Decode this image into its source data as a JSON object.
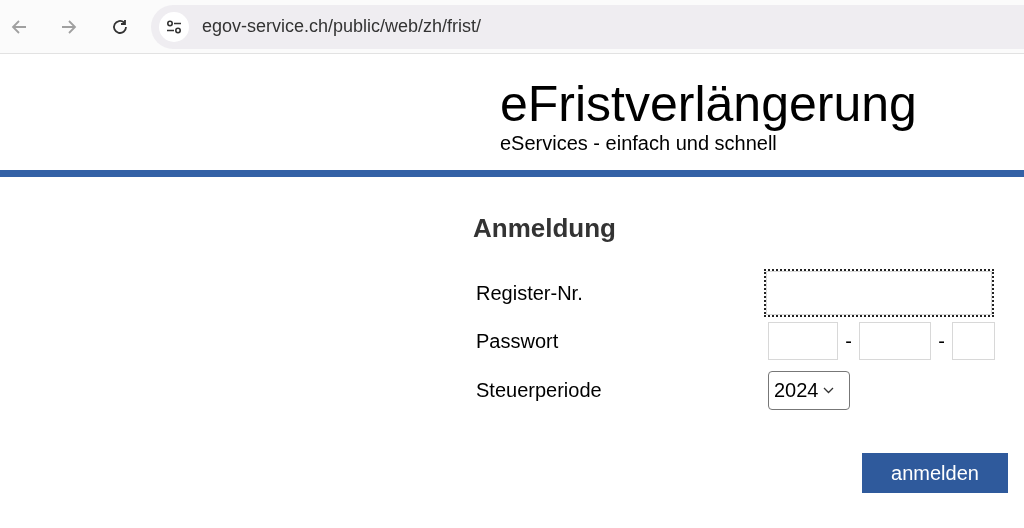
{
  "browser": {
    "url": "egov-service.ch/public/web/zh/frist/"
  },
  "header": {
    "title": "eFristverlängerung",
    "subtitle": "eServices - einfach und schnell"
  },
  "form": {
    "heading": "Anmeldung",
    "register": {
      "label": "Register-Nr.",
      "focused": true
    },
    "password": {
      "label": "Passwort",
      "separators": [
        "-",
        "-"
      ]
    },
    "period": {
      "label": "Steuerperiode",
      "value": "2024"
    },
    "submit": "anmelden"
  }
}
